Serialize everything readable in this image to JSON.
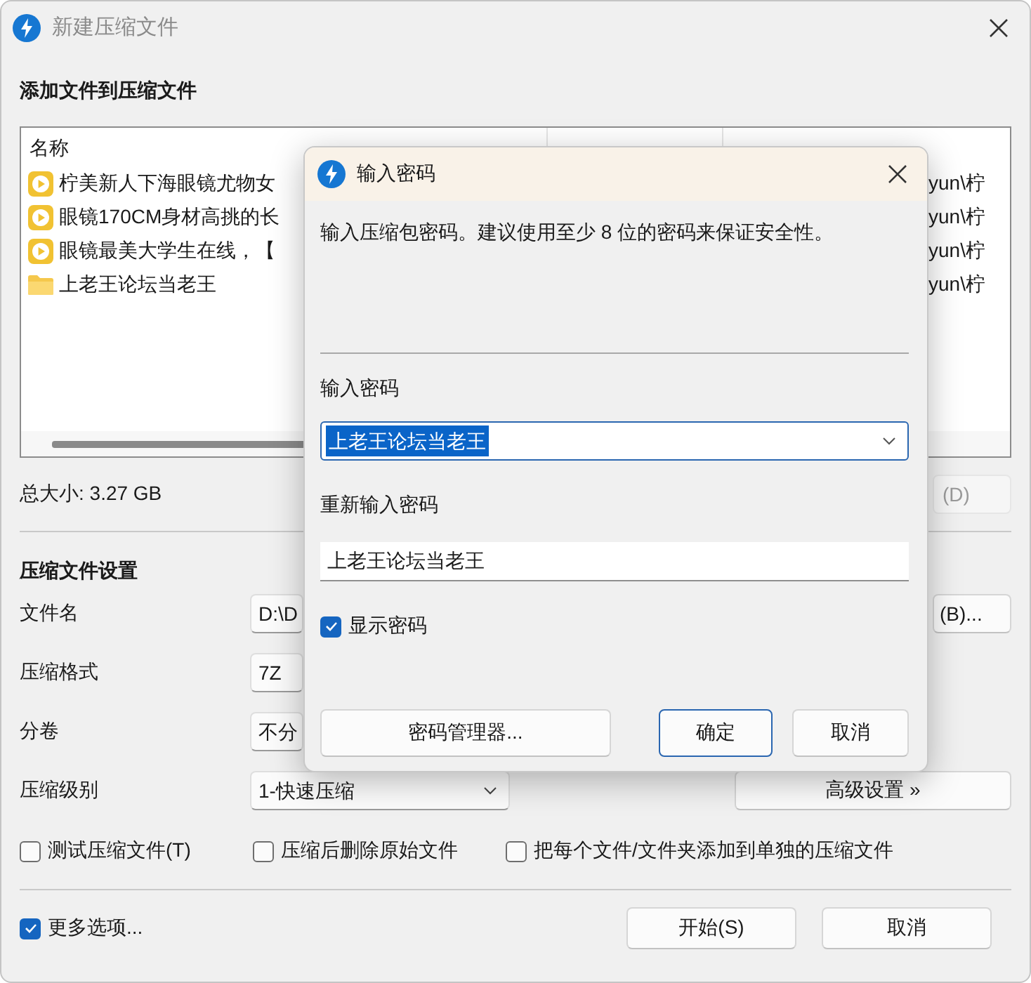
{
  "window": {
    "title": "新建压缩文件"
  },
  "files_section": {
    "heading": "添加文件到压缩文件",
    "column_header": "名称",
    "files": [
      {
        "kind": "video",
        "name": "柠美新人下海眼镜尤物女",
        "path": "yun\\柠"
      },
      {
        "kind": "video",
        "name": "眼镜170CM身材高挑的长",
        "path": "yun\\柠"
      },
      {
        "kind": "video",
        "name": "眼镜最美大学生在线，【",
        "path": "yun\\柠"
      },
      {
        "kind": "folder",
        "name": "上老王论坛当老王",
        "path": "yun\\柠"
      }
    ],
    "total": "总大小: 3.27 GB",
    "add_button": "(D)"
  },
  "settings": {
    "heading": "压缩文件设置",
    "rows": [
      {
        "kind": "field",
        "label": "文件名",
        "value": "D:\\D",
        "button": "(B)..."
      },
      {
        "kind": "field",
        "label": "压缩格式",
        "value": "7Z"
      },
      {
        "kind": "field",
        "label": "分卷",
        "value": "不分"
      },
      {
        "kind": "dropdown",
        "label": "压缩级别",
        "value": "1-快速压缩",
        "button": "高级设置 »"
      }
    ],
    "options": [
      {
        "label": "测试压缩文件(T)",
        "checked": false
      },
      {
        "label": "压缩后删除原始文件",
        "checked": false
      },
      {
        "label": "把每个文件/文件夹添加到单独的压缩文件",
        "checked": false
      }
    ]
  },
  "footer": {
    "more_options": {
      "label": "更多选项...",
      "checked": true
    },
    "buttons": [
      {
        "label": "开始(S)"
      },
      {
        "label": "取消"
      }
    ]
  },
  "password_dialog": {
    "title": "输入密码",
    "description": "输入压缩包密码。建议使用至少 8 位的密码来保证安全性。",
    "password_label": "输入密码",
    "password": {
      "value": "上老王论坛当老王",
      "selected": true
    },
    "repeat_label": "重新输入密码",
    "repeat_value": "上老王论坛当老王",
    "show_password": {
      "label": "显示密码",
      "checked": true
    },
    "buttons": [
      {
        "kind": "plain",
        "label": "密码管理器..."
      },
      {
        "kind": "default",
        "label": "确定"
      },
      {
        "kind": "plain",
        "label": "取消"
      }
    ]
  }
}
